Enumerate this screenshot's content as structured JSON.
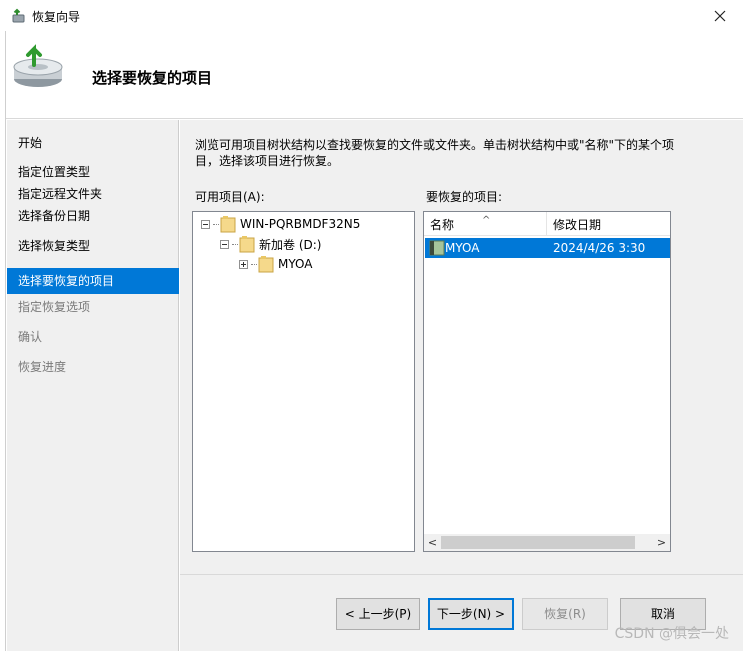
{
  "window": {
    "title": "恢复向导"
  },
  "header": {
    "title": "选择要恢复的项目"
  },
  "sidebar": {
    "items": [
      {
        "label": "开始",
        "state": "normal"
      },
      {
        "label": "指定位置类型",
        "state": "normal"
      },
      {
        "label": "指定远程文件夹",
        "state": "normal"
      },
      {
        "label": "选择备份日期",
        "state": "normal"
      },
      {
        "label": "选择恢复类型",
        "state": "normal"
      },
      {
        "label": "选择要恢复的项目",
        "state": "selected"
      },
      {
        "label": "指定恢复选项",
        "state": "disabled"
      },
      {
        "label": "确认",
        "state": "disabled"
      },
      {
        "label": "恢复进度",
        "state": "disabled"
      }
    ]
  },
  "main": {
    "description": "浏览可用项目树状结构以查找要恢复的文件或文件夹。单击树状结构中或\"名称\"下的某个项目，选择该项目进行恢复。",
    "available_label": "可用项目(A):",
    "restore_label": "要恢复的项目:",
    "tree": [
      {
        "label": "WIN-PQRBMDF32N5"
      },
      {
        "label": "新加卷 (D:)"
      },
      {
        "label": "MYOA"
      }
    ],
    "list": {
      "columns": [
        "名称",
        "修改日期"
      ],
      "rows": [
        {
          "name": "MYOA",
          "date": "2024/4/26 3:30"
        }
      ]
    }
  },
  "buttons": {
    "back": "< 上一步(P)",
    "next": "下一步(N) >",
    "recover": "恢复(R)",
    "cancel": "取消"
  },
  "watermark": "CSDN @俱会一处",
  "colors": {
    "accent": "#0078d7",
    "panel": "#f0f0f0"
  }
}
